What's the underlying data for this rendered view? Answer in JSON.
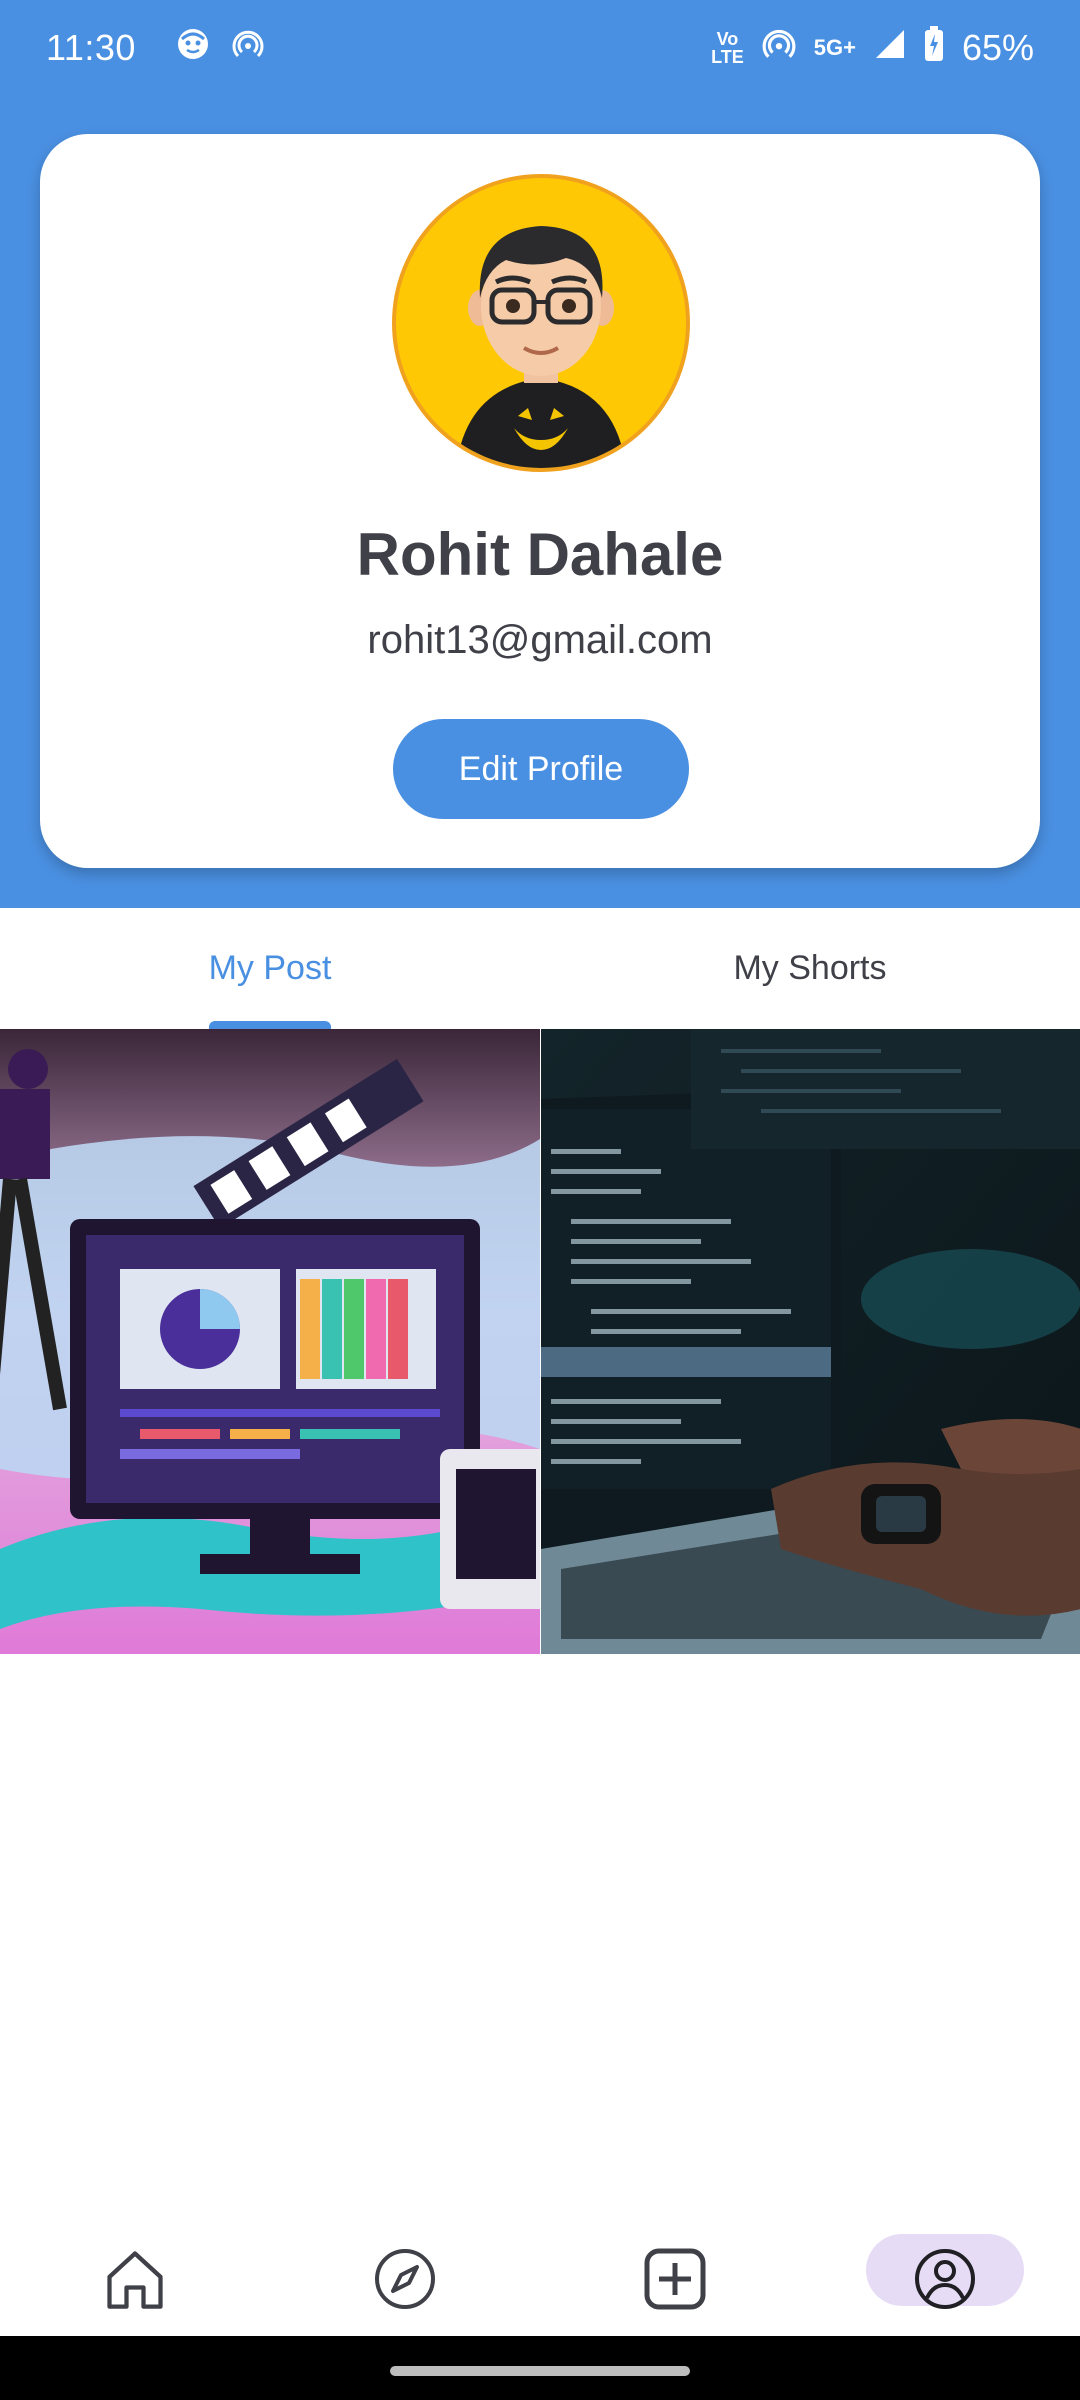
{
  "status_bar": {
    "time": "11:30",
    "left_icons": [
      "face-icon",
      "hotspot-icon"
    ],
    "volte_top": "Vo",
    "volte_bottom": "LTE",
    "network": "5G+",
    "battery": "65%"
  },
  "profile": {
    "name": "Rohit Dahale",
    "email": "rohit13@gmail.com",
    "edit_button_label": "Edit Profile",
    "avatar_icon": "avatar-icon"
  },
  "tabs": [
    {
      "label": "My Post",
      "active": true
    },
    {
      "label": "My Shorts",
      "active": false
    }
  ],
  "posts": [
    {
      "name": "video-editing-post",
      "icon": "video-editor-icon"
    },
    {
      "name": "coding-laptop-post",
      "icon": "laptop-code-icon"
    }
  ],
  "bottom_nav": [
    {
      "name": "home",
      "icon": "home-icon",
      "active": false
    },
    {
      "name": "explore",
      "icon": "compass-icon",
      "active": false
    },
    {
      "name": "create",
      "icon": "add-square-icon",
      "active": false
    },
    {
      "name": "profile",
      "icon": "profile-icon",
      "active": true
    }
  ],
  "colors": {
    "primary": "#4a90e2",
    "text_dark": "#3f4048",
    "avatar_bg": "#ffc804",
    "nav_active_bg": "#e6dcf6"
  }
}
